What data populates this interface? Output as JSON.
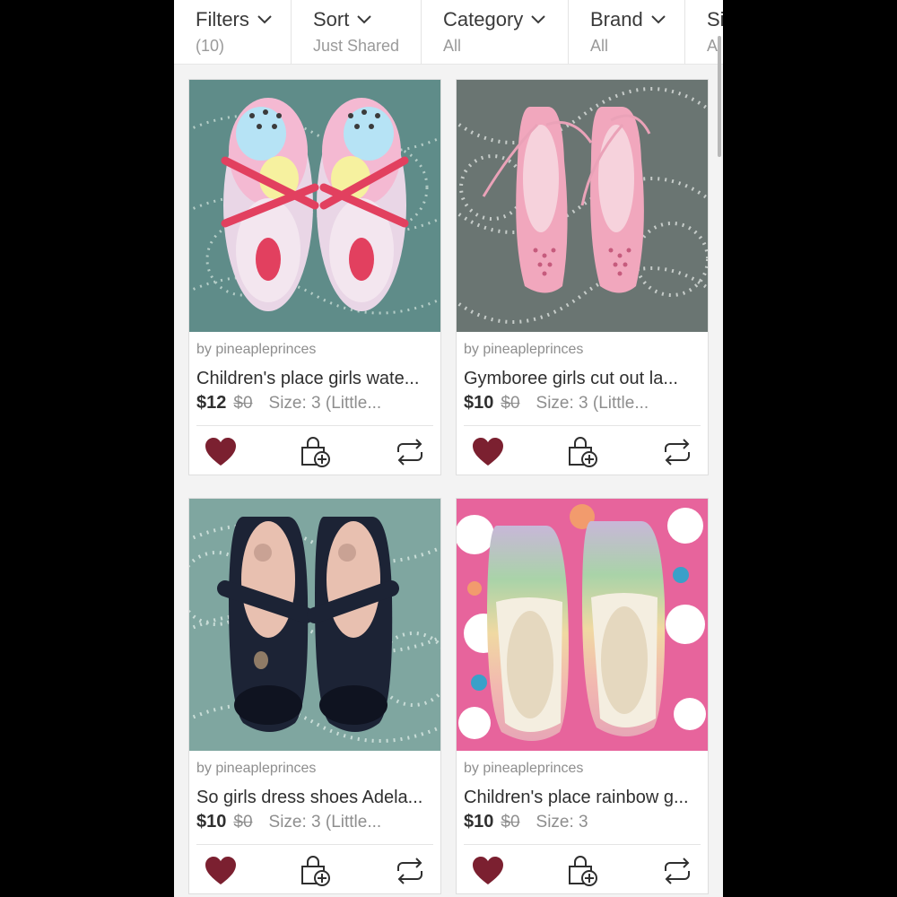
{
  "filters": [
    {
      "label": "Filters",
      "value": "(10)"
    },
    {
      "label": "Sort",
      "value": "Just Shared"
    },
    {
      "label": "Category",
      "value": "All"
    },
    {
      "label": "Brand",
      "value": "All"
    },
    {
      "label": "Si",
      "value": "Al"
    }
  ],
  "colors": {
    "like": "#7b2030",
    "accent": "#2f2f2f",
    "muted": "#8e8e8e"
  },
  "icons": {
    "like": "heart-icon",
    "bundle": "add-to-bundle-icon",
    "share": "share-icon",
    "dropdown": "chevron-down-icon"
  },
  "listings": [
    {
      "seller": "by pineapleprinces",
      "title": "Children's place girls wate...",
      "price": "$12",
      "original_price": "$0",
      "size": "Size: 3 (Little...",
      "liked": true
    },
    {
      "seller": "by pineapleprinces",
      "title": "Gymboree girls cut out la...",
      "price": "$10",
      "original_price": "$0",
      "size": "Size: 3 (Little...",
      "liked": true
    },
    {
      "seller": "by pineapleprinces",
      "title": "So girls dress shoes Adela...",
      "price": "$10",
      "original_price": "$0",
      "size": "Size: 3 (Little...",
      "liked": true
    },
    {
      "seller": "by pineapleprinces",
      "title": "Children's place rainbow g...",
      "price": "$10",
      "original_price": "$0",
      "size": "Size: 3",
      "liked": true
    }
  ]
}
